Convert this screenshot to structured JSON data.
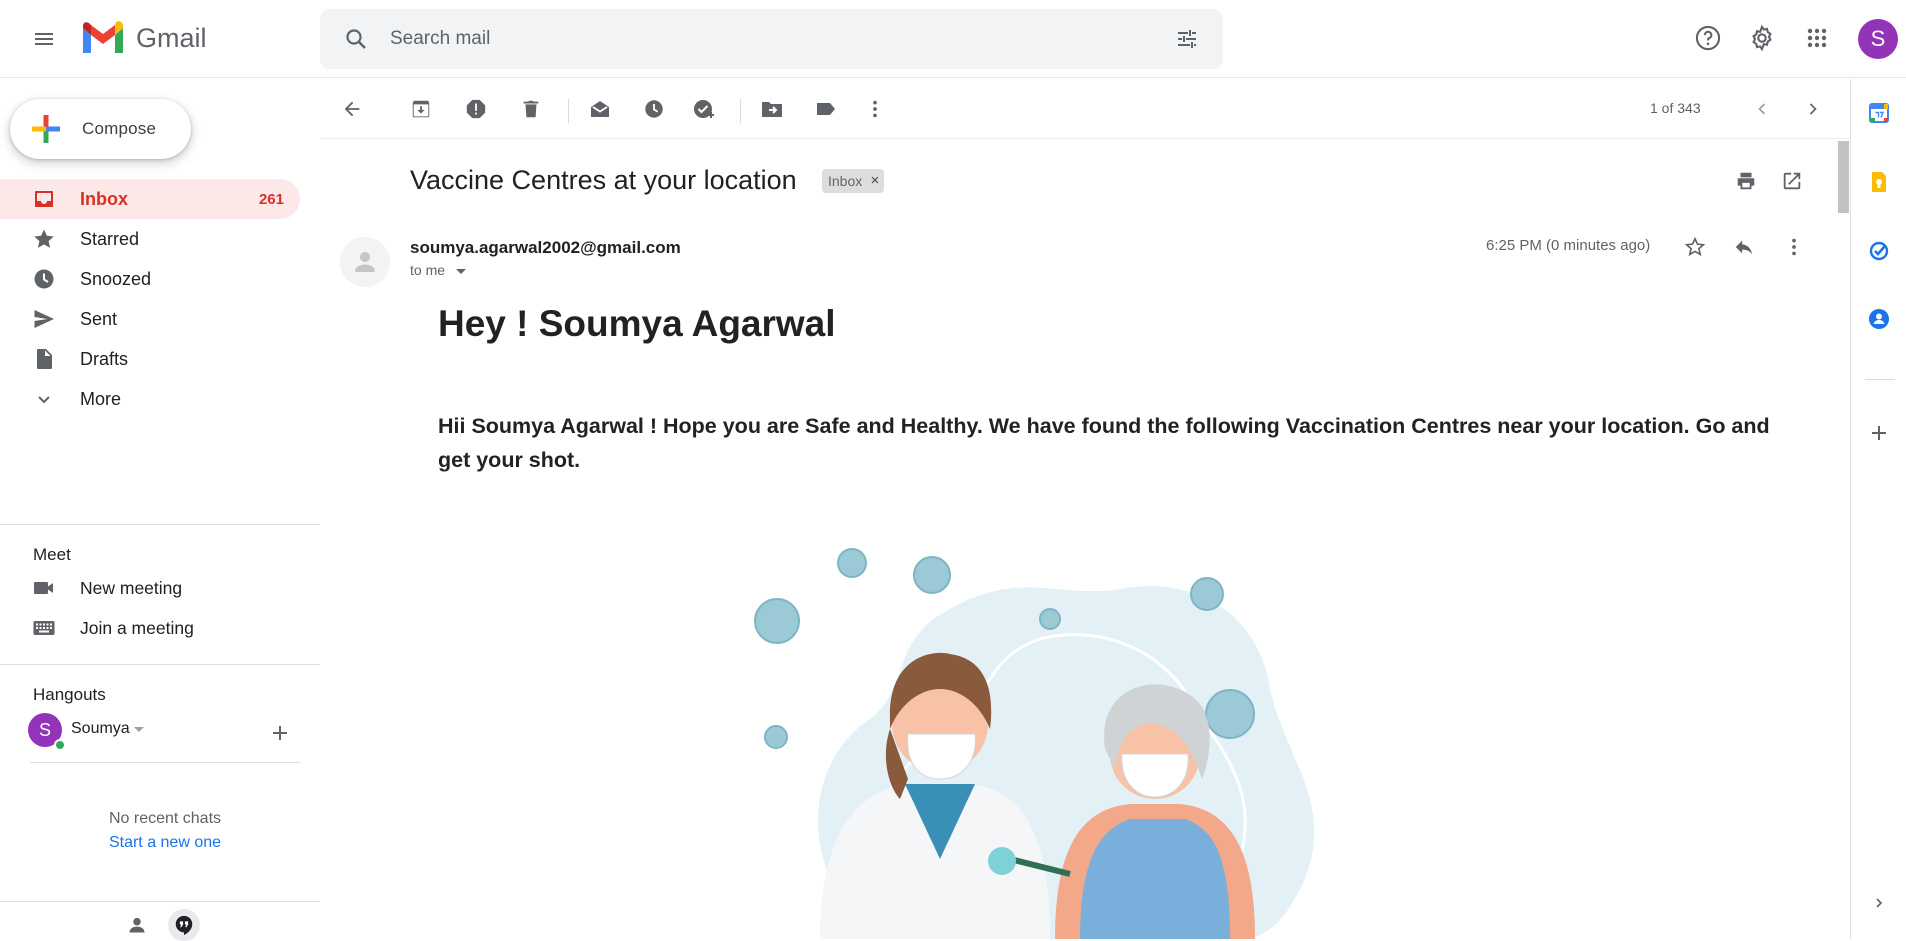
{
  "app": {
    "name": "Gmail"
  },
  "search": {
    "placeholder": "Search mail"
  },
  "account": {
    "initial": "S"
  },
  "compose": {
    "label": "Compose"
  },
  "nav": [
    {
      "label": "Inbox",
      "count": "261"
    },
    {
      "label": "Starred",
      "count": ""
    },
    {
      "label": "Snoozed",
      "count": ""
    },
    {
      "label": "Sent",
      "count": ""
    },
    {
      "label": "Drafts",
      "count": ""
    },
    {
      "label": "More",
      "count": ""
    }
  ],
  "meet": {
    "title": "Meet",
    "new_meeting": "New meeting",
    "join_meeting": "Join a meeting"
  },
  "hangouts": {
    "title": "Hangouts",
    "user": "Soumya",
    "user_initial": "S",
    "no_chats": "No recent chats",
    "start_new": "Start a new one"
  },
  "toolbar": {
    "pager": "1 of 343"
  },
  "email": {
    "subject": "Vaccine Centres at your location",
    "label_chip": "Inbox",
    "chip_close": "×",
    "sender": "soumya.agarwal2002@gmail.com",
    "recipient": "to me",
    "time": "6:25 PM (0 minutes ago)",
    "heading": "Hey ! Soumya Agarwal",
    "body": "Hii Soumya Agarwal ! Hope you are Safe and Healthy. We have found the following Vaccination Centres near your location. Go and get your shot."
  },
  "colors": {
    "accent_red": "#d93025",
    "inbox_bg": "#fce8e6",
    "avatar": "#9334b8",
    "link": "#1a73e8"
  }
}
